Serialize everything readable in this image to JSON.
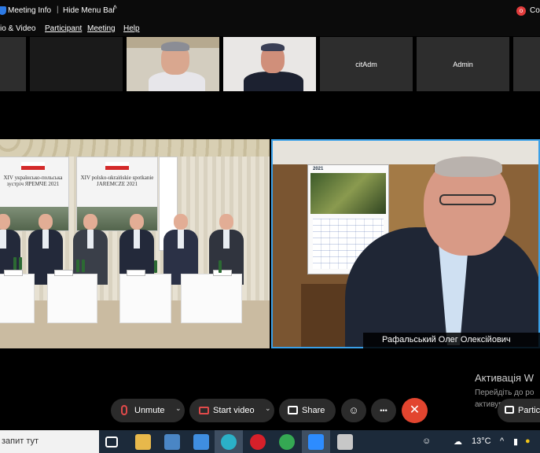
{
  "topbar": {
    "meeting_info": "Meeting Info",
    "separator": "|",
    "hide_menu": "Hide Menu Bar",
    "recording_badge": "o",
    "recording_label": "Co"
  },
  "menu": {
    "audio_video": "io & Video",
    "participant": "Participant",
    "meeting": "Meeting",
    "help": "Help"
  },
  "thumbnails": [
    {
      "label": ""
    },
    {
      "label": ""
    },
    {
      "label": ""
    },
    {
      "label": ""
    },
    {
      "label": "citAdm"
    },
    {
      "label": "Admin"
    }
  ],
  "stage": {
    "banner_left": "XIV українсько-польська зустріч ЯРЕМЧЕ 2021",
    "banner_right": "XIV polsko-ukraińskie spotkanie JAREMCZE 2021",
    "calendar_year": "2021",
    "speaker_name": "Рафальський Олег Олексійович"
  },
  "watermark": {
    "title": "Активація W",
    "line1": "Перейдіть до ро",
    "line2": "активувати Win"
  },
  "controls": {
    "unmute": "Unmute",
    "start_video": "Start video",
    "share": "Share",
    "more": "•••",
    "leave": "✕",
    "participants": "Partic"
  },
  "taskbar": {
    "search_placeholder": "запит тут",
    "temperature": "13°C"
  },
  "colors": {
    "active_speaker_border": "#3aa0e8",
    "leave_button": "#e2452f",
    "muted_icon": "#e04a4a"
  }
}
